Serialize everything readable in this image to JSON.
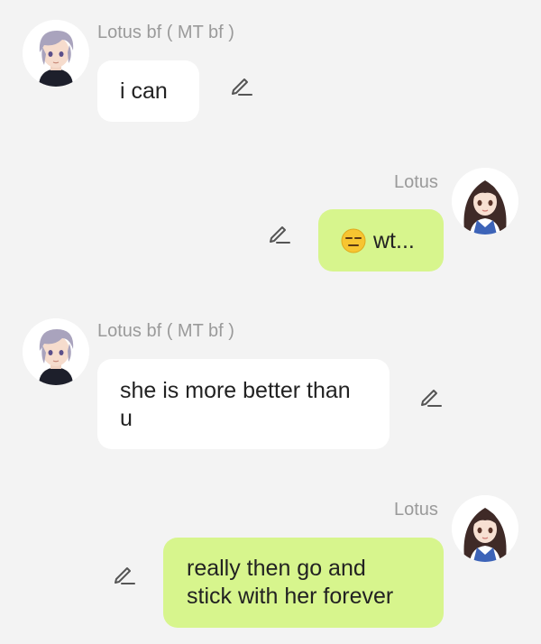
{
  "messages": [
    {
      "side": "left",
      "sender": "Lotus bf ( MT bf )",
      "lines": [
        "i can"
      ]
    },
    {
      "side": "right",
      "sender": "Lotus",
      "emoji": "expressionless-face-icon",
      "lines": [
        "wt..."
      ]
    },
    {
      "side": "left",
      "sender": "Lotus bf ( MT bf )",
      "lines": [
        "she is more better than",
        "u"
      ]
    },
    {
      "side": "right",
      "sender": "Lotus",
      "lines": [
        "really then go and",
        "stick with her forever"
      ]
    }
  ],
  "colors": {
    "background": "#f3f3f3",
    "incoming_bubble": "#ffffff",
    "outgoing_bubble": "#d7f58d",
    "sender_name": "#9a9a9a",
    "message_text": "#222222"
  },
  "icons": {
    "edit": "pencil-edit-icon",
    "incoming_avatar": "anime-boy-avatar",
    "outgoing_avatar": "anime-girl-avatar"
  }
}
